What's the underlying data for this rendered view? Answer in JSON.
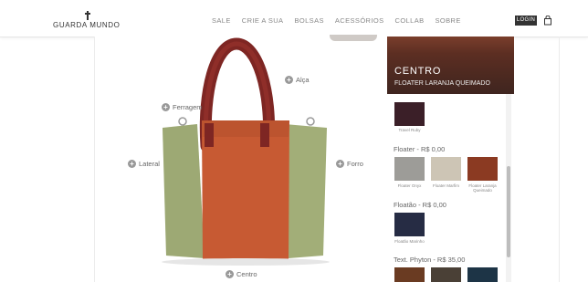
{
  "brand": {
    "name": "GUARDA MUNDO"
  },
  "nav": {
    "items": [
      "SALE",
      "CRIE A SUA",
      "BOLSAS",
      "ACESSÓRIOS",
      "COLLAB",
      "SOBRE"
    ]
  },
  "header": {
    "login_label": "LOGIN"
  },
  "hotspots": {
    "alca": "Alça",
    "ferragem": "Ferragem",
    "lateral": "Lateral",
    "forro": "Forro",
    "centro": "Centro",
    "icon": "+"
  },
  "panel": {
    "title": "CENTRO",
    "subtitle": "FLOATER LARANJA QUEIMADO",
    "top_swatch": {
      "label": "Travel Ruby",
      "color": "#3b1f28"
    },
    "sections": [
      {
        "title": "Floater - R$ 0,00",
        "swatches": [
          {
            "label": "Floater Onyx",
            "color": "#9d9c98"
          },
          {
            "label": "Floater Marfim",
            "color": "#cdc5b5"
          },
          {
            "label": "Floater Laranja Queimado",
            "color": "#8b3a22"
          }
        ]
      },
      {
        "title": "Floatão - R$ 0,00",
        "swatches": [
          {
            "label": "Floatão Marinho",
            "color": "#262c44"
          }
        ]
      },
      {
        "title": "Text. Phyton - R$ 35,00",
        "swatches": [
          {
            "label": "",
            "color": "#6a3b22"
          },
          {
            "label": "",
            "color": "#4a4036"
          },
          {
            "label": "",
            "color": "#1d3446"
          }
        ]
      }
    ]
  },
  "colors": {
    "handle": "#8a2a26",
    "center_panel": "#c85a33",
    "side_panel": "#a3b07a",
    "header_bg": "#5c2e22"
  }
}
